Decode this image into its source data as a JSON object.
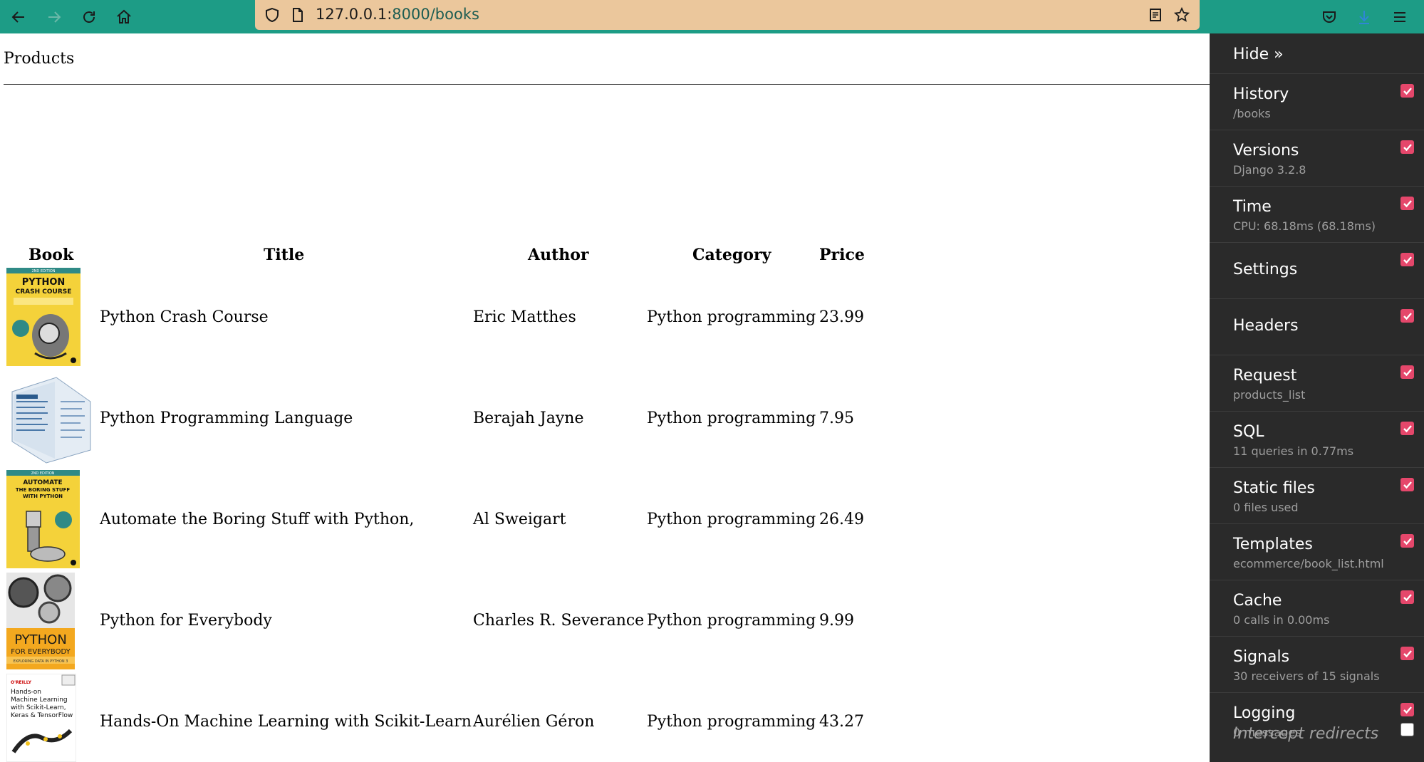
{
  "browser": {
    "url_host": "127.0.0.1:",
    "url_path": "8000/books",
    "icons": [
      "back-arrow-icon",
      "forward-arrow-icon",
      "reload-icon",
      "home-icon",
      "shield-icon",
      "page-icon",
      "reader-view-icon",
      "star-icon",
      "pocket-icon",
      "download-icon",
      "hamburger-menu-icon"
    ]
  },
  "page": {
    "title": "Products",
    "table": {
      "headers": [
        "Book",
        "Title",
        "Author",
        "Category",
        "Price"
      ],
      "rows": [
        {
          "title": "Python Crash Course",
          "author": "Eric Matthes",
          "category": "Python programming",
          "price": "23.99"
        },
        {
          "title": "Python Programming Language",
          "author": "Berajah Jayne",
          "category": "Python programming",
          "price": "7.95"
        },
        {
          "title": "Automate the Boring Stuff with Python,",
          "author": "Al Sweigart",
          "category": "Python programming",
          "price": "26.49"
        },
        {
          "title": "Python for Everybody",
          "author": "Charles R. Severance",
          "category": "Python programming",
          "price": "9.99"
        },
        {
          "title": "Hands-On Machine Learning with Scikit-Learn",
          "author": "Aurélien Géron",
          "category": "Python programming",
          "price": "43.27"
        }
      ]
    },
    "covers": {
      "crash_course": {
        "edition": "2ND EDITION",
        "line1": "PYTHON",
        "line2": "CRASH COURSE",
        "badge": "OVER 1,000,000 COPIES SOLD"
      },
      "automate": {
        "edition": "2ND EDITION",
        "line1": "AUTOMATE",
        "line2": "THE BORING STUFF",
        "line3": "WITH PYTHON",
        "badge": "OVER 500,000 COPIES SOLD"
      },
      "everybody": {
        "line1": "PYTHON",
        "line2": "FOR EVERYBODY",
        "line3": "EXPLORING DATA IN PYTHON 3"
      },
      "handson": {
        "publisher": "O'REILLY",
        "line1": "Hands-on",
        "line2": "Machine Learning",
        "line3": "with Scikit-Learn,",
        "line4": "Keras & TensorFlow"
      }
    }
  },
  "toolbar": {
    "hide_label": "Hide »",
    "panels": [
      {
        "title": "History",
        "subtitle": "/books",
        "checked": true
      },
      {
        "title": "Versions",
        "subtitle": "Django 3.2.8",
        "checked": true
      },
      {
        "title": "Time",
        "subtitle": "CPU: 68.18ms (68.18ms)",
        "checked": true
      },
      {
        "title": "Settings",
        "subtitle": "",
        "checked": true
      },
      {
        "title": "Headers",
        "subtitle": "",
        "checked": true
      },
      {
        "title": "Request",
        "subtitle": "products_list",
        "checked": true
      },
      {
        "title": "SQL",
        "subtitle": "11 queries in 0.77ms",
        "checked": true
      },
      {
        "title": "Static files",
        "subtitle": "0 files used",
        "checked": true
      },
      {
        "title": "Templates",
        "subtitle": "ecommerce/book_list.html",
        "checked": true
      },
      {
        "title": "Cache",
        "subtitle": "0 calls in 0.00ms",
        "checked": true
      },
      {
        "title": "Signals",
        "subtitle": "30 receivers of 15 signals",
        "checked": true
      },
      {
        "title": "Logging",
        "subtitle": "0 messages",
        "checked": true
      }
    ],
    "intercept_redirects": {
      "label": "Intercept redirects",
      "checked": false
    }
  },
  "colors": {
    "chrome_bg": "#1d9c86",
    "urlbar_bg": "#ebc79c",
    "toolbar_bg": "#2a2a2a",
    "checkbox_on": "#e5476b"
  }
}
